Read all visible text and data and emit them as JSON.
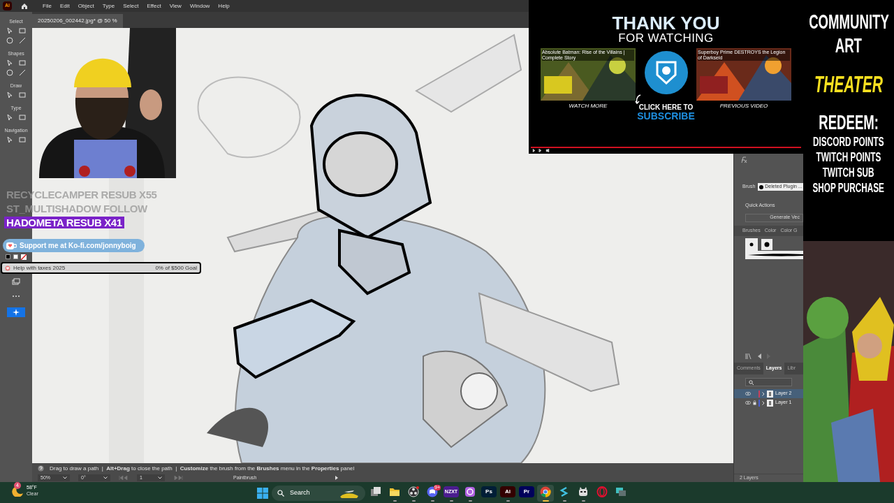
{
  "menu_bar": {
    "app_logo": "Ai",
    "items": [
      "File",
      "Edit",
      "Object",
      "Type",
      "Select",
      "Effect",
      "View",
      "Window",
      "Help"
    ]
  },
  "document_tab": {
    "title": "20250206_002442.jpg* @ 50 %"
  },
  "toolbar": {
    "sections": [
      "Select",
      "Shapes",
      "Draw",
      "Type",
      "Navigation"
    ]
  },
  "alerts": [
    {
      "text": "RECYCLECAMPER  RESUB X55",
      "highlighted": false
    },
    {
      "text": "ST_MULTISHADOW  FOLLOW",
      "highlighted": false
    },
    {
      "text": "HADOMETA  RESUB X41",
      "highlighted": true
    }
  ],
  "kofi": {
    "text": "Support me at Ko-fi.com/jonnyboig"
  },
  "goal": {
    "title": "Help with taxes 2025",
    "progress": "0% of $500 Goal",
    "level": 0
  },
  "video_end_screen": {
    "heading": "THANK YOU",
    "subheading": "FOR WATCHING",
    "videos": [
      {
        "title": "Absolute Batman: Rise of the Villains | Complete Story",
        "caption": "WATCH MORE"
      },
      {
        "title": "Superboy Prime DESTROYS the Legion of Darkseid",
        "caption": "PREVIOUS VIDEO"
      }
    ],
    "subscribe": [
      "CLICK HERE TO",
      "SUBSCRIBE"
    ],
    "level": 1
  },
  "properties_panel": {
    "brush_label": "Brush",
    "brush_value": "Deleted Plugin ...",
    "quick_actions": "Quick Actions",
    "action_button": "Generate Vec"
  },
  "brush_panel": {
    "tabs": [
      "Brushes",
      "Color",
      "Color G"
    ]
  },
  "layers_panel": {
    "tabs": [
      {
        "label": "Comments",
        "selected": false
      },
      {
        "label": "Layers",
        "selected": true
      },
      {
        "label": "Libr",
        "selected": false
      }
    ],
    "layers": [
      {
        "name": "Layer 2",
        "selected": true,
        "locked": false,
        "color": "#c8405a"
      },
      {
        "name": "Layer 1",
        "selected": false,
        "locked": true,
        "color": "#4a5fd0"
      }
    ],
    "count": "2 Layers"
  },
  "status_hint": "Drag to draw a path  |  **Alt+Drag** to close the path  |  **Customize** the brush from the **Brushes** menu in the **Properties** panel",
  "bottom_controls": {
    "zoom": "50%",
    "rotation": "0°",
    "artboard": "1",
    "tool": "Paintbrush"
  },
  "promo": [
    {
      "text": "COMMUNITY",
      "kind": "title"
    },
    {
      "text": "ART",
      "kind": "title"
    },
    {
      "text": "THEATER",
      "kind": "accent"
    },
    {
      "text": "REDEEM:",
      "kind": "title"
    },
    {
      "text": "DISCORD POINTS",
      "kind": "item"
    },
    {
      "text": "TWITCH POINTS",
      "kind": "item"
    },
    {
      "text": "TWITCH SUB",
      "kind": "item"
    },
    {
      "text": "SHOP PURCHASE",
      "kind": "item"
    }
  ],
  "taskbar": {
    "weather": {
      "temperature": "58°F",
      "condition": "Clear",
      "badge": "4"
    },
    "search": "Search",
    "apps": [
      {
        "kind": "taskview",
        "running": false,
        "selected": false
      },
      {
        "kind": "folder",
        "running": true,
        "selected": false
      },
      {
        "kind": "obs",
        "running": true,
        "selected": false
      },
      {
        "kind": "discord",
        "running": true,
        "selected": false,
        "badge": "9+"
      },
      {
        "kind": "letters",
        "glyph": "NZXT",
        "color": "#4b1d8f",
        "running": true,
        "selected": false
      },
      {
        "kind": "camera",
        "running": true,
        "selected": false
      },
      {
        "kind": "letters",
        "glyph": "Ps",
        "color": "#001e36",
        "running": false,
        "selected": false
      },
      {
        "kind": "letters",
        "glyph": "Ai",
        "color": "#330000",
        "running": true,
        "selected": false
      },
      {
        "kind": "letters",
        "glyph": "Pr",
        "color": "#00005b",
        "running": false,
        "selected": false
      },
      {
        "kind": "chrome",
        "running": true,
        "selected": true
      },
      {
        "kind": "swirl",
        "running": true,
        "selected": false
      },
      {
        "kind": "robot",
        "running": true,
        "selected": false
      },
      {
        "kind": "opera",
        "running": false,
        "selected": false
      },
      {
        "kind": "screens",
        "running": false,
        "selected": false
      }
    ]
  }
}
